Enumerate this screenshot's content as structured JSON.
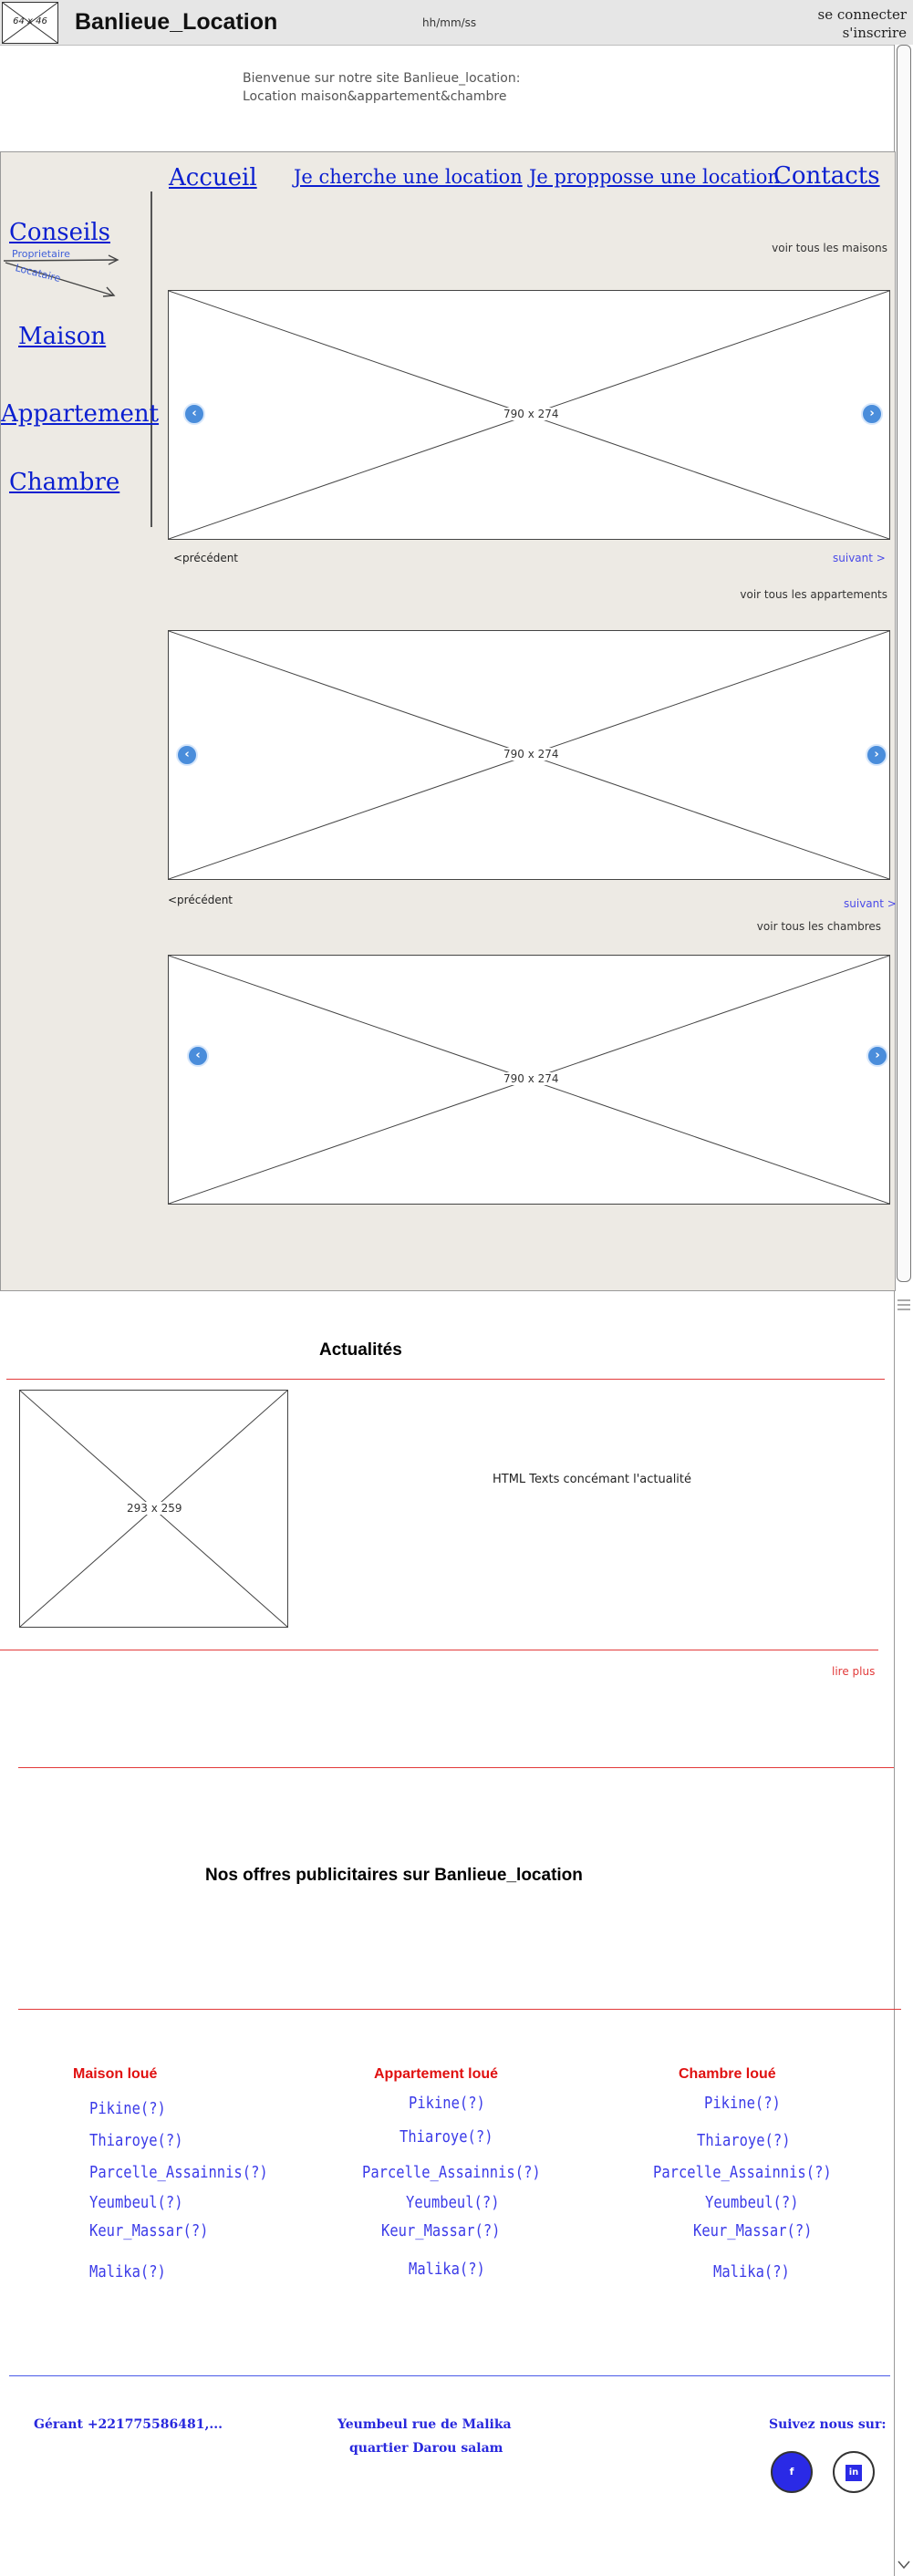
{
  "header": {
    "logo_label": "64 x 46",
    "site_title": "Banlieue_Location",
    "time_placeholder": "hh/mm/ss",
    "login_label": "se connecter",
    "register_label": "s'inscrire"
  },
  "welcome": {
    "line1": "Bienvenue sur notre site Banlieue_location:",
    "line2": "Location maison&appartement&chambre"
  },
  "top_nav": {
    "home": "Accueil",
    "search": "Je cherche une location",
    "offer": "Je propposse une location",
    "contacts": "Contacts"
  },
  "sidebar": {
    "conseils": "Conseils",
    "annot_owner": "Proprietaire",
    "annot_tenant": "Locataire",
    "maison": "Maison",
    "appartement": "Appartement",
    "chambre": "Chambre"
  },
  "carousels": {
    "houses": {
      "see_all": "voir tous les maisons",
      "dims": "790 x 274",
      "prev": "<précédent",
      "next": "suivant >"
    },
    "apartments": {
      "see_all": "voir tous les appartements",
      "dims": "790 x 274",
      "prev": "<précédent",
      "next": "suivant >"
    },
    "rooms": {
      "see_all": "voir tous les chambres",
      "dims": "790 x 274"
    }
  },
  "news": {
    "title": "Actualités",
    "image_dims": "293 x 259",
    "text": "HTML Texts concémant l'actualité",
    "read_more": "lire plus"
  },
  "ads": {
    "title": "Nos offres publicitaires sur Banlieue_location"
  },
  "listings": {
    "maison": {
      "title": "Maison loué",
      "items": [
        "Pikine(?)",
        "Thiaroye(?)",
        "Parcelle_Assainnis(?)",
        "Yeumbeul(?)",
        "Keur_Massar(?)",
        "Malika(?)"
      ]
    },
    "appartement": {
      "title": "Appartement loué",
      "items": [
        "Pikine(?)",
        "Thiaroye(?)",
        "Parcelle_Assainnis(?)",
        "Yeumbeul(?)",
        "Keur_Massar(?)",
        "Malika(?)"
      ]
    },
    "chambre": {
      "title": "Chambre loué",
      "items": [
        "Pikine(?)",
        "Thiaroye(?)",
        "Parcelle_Assainnis(?)",
        "Yeumbeul(?)",
        "Keur_Massar(?)",
        "Malika(?)"
      ]
    }
  },
  "footer": {
    "manager": "Gérant +221775586481,...",
    "address1": "Yeumbeul rue de Malika",
    "address2": "quartier Darou salam",
    "follow": "Suivez nous sur:",
    "facebook": "f",
    "linkedin": "in"
  },
  "colors": {
    "link_blue": "#0b1fd0",
    "listing_red": "#e01010",
    "divider_red": "#e23a3a",
    "footer_blue": "#2828dd",
    "panel_bg": "#edeae4"
  }
}
